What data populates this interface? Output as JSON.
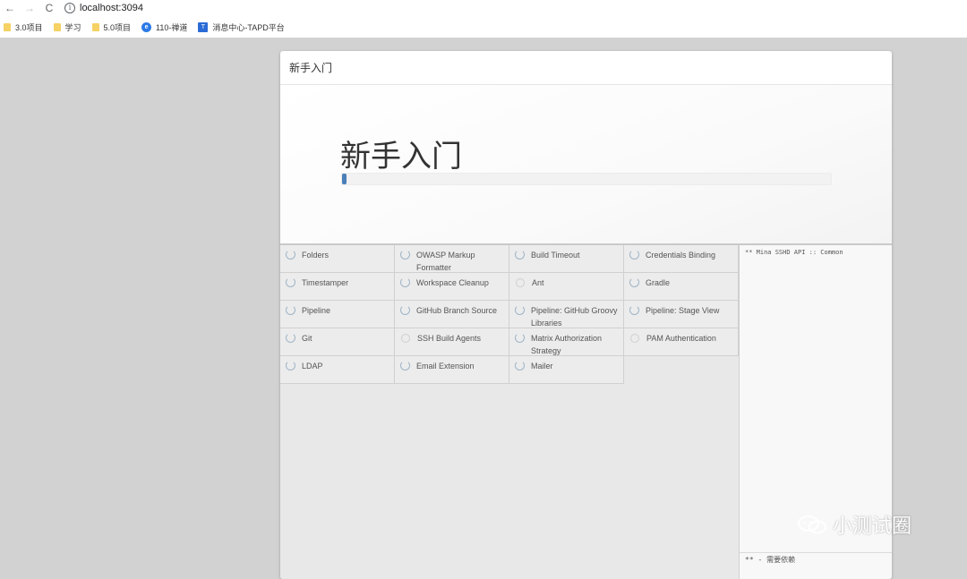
{
  "browser": {
    "url": "localhost:3094",
    "back_icon": "←",
    "forward_icon": "→",
    "reload_icon": "C",
    "bookmarks": [
      {
        "label": "3.0项目",
        "icon": "folder-icon"
      },
      {
        "label": "学习",
        "icon": "folder-icon"
      },
      {
        "label": "5.0项目",
        "icon": "folder-icon"
      },
      {
        "label": "110-禅道",
        "icon": "globe-icon"
      },
      {
        "label": "消息中心-TAPD平台",
        "icon": "tapd-icon"
      }
    ]
  },
  "dialog": {
    "header_title": "新手入门",
    "hero_title": "新手入门",
    "progress_fraction": 0.01
  },
  "plugins": [
    {
      "name": "Folders",
      "state": "installing"
    },
    {
      "name": "OWASP Markup Formatter",
      "state": "installing"
    },
    {
      "name": "Build Timeout",
      "state": "installing"
    },
    {
      "name": "Credentials Binding",
      "state": "installing"
    },
    {
      "name": "Timestamper",
      "state": "installing"
    },
    {
      "name": "Workspace Cleanup",
      "state": "installing"
    },
    {
      "name": "Ant",
      "state": "pending"
    },
    {
      "name": "Gradle",
      "state": "installing"
    },
    {
      "name": "Pipeline",
      "state": "installing"
    },
    {
      "name": "GitHub Branch Source",
      "state": "installing"
    },
    {
      "name": "Pipeline: GitHub Groovy Libraries",
      "state": "installing"
    },
    {
      "name": "Pipeline: Stage View",
      "state": "installing"
    },
    {
      "name": "Git",
      "state": "installing"
    },
    {
      "name": "SSH Build Agents",
      "state": "pending"
    },
    {
      "name": "Matrix Authorization Strategy",
      "state": "installing"
    },
    {
      "name": "PAM Authentication",
      "state": "pending"
    },
    {
      "name": "LDAP",
      "state": "installing"
    },
    {
      "name": "Email Extension",
      "state": "installing"
    },
    {
      "name": "Mailer",
      "state": "installing"
    }
  ],
  "log": {
    "first_line": "** Mina SSHD API :: Common",
    "footer": "** - 需要依赖"
  },
  "watermark": {
    "text": "小测试圈"
  },
  "colors": {
    "progress": "#4a7fb8",
    "page_bg": "#d2d2d2"
  }
}
